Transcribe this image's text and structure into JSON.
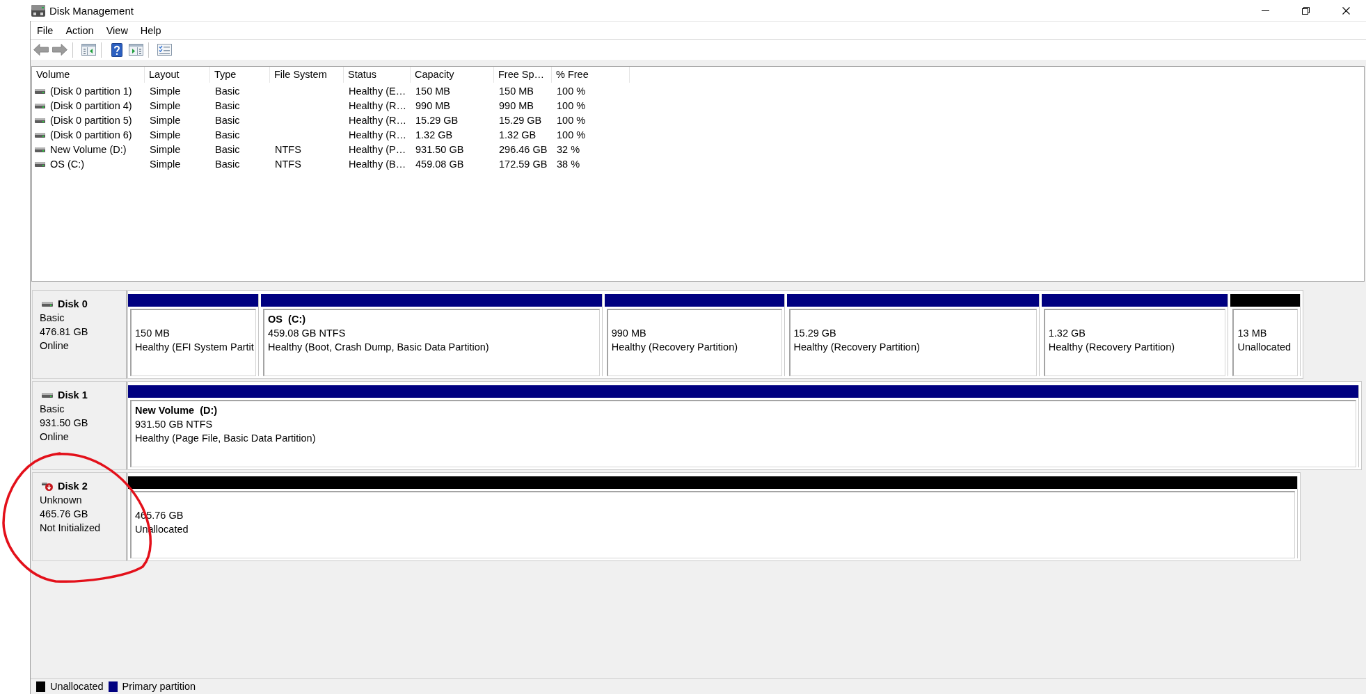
{
  "window": {
    "title": "Disk Management"
  },
  "menu": [
    "File",
    "Action",
    "View",
    "Help"
  ],
  "toolbar": [
    {
      "buttons": [
        {
          "kind": "back",
          "disabled": true
        },
        {
          "kind": "forward",
          "disabled": true
        }
      ]
    },
    {
      "buttons": [
        {
          "kind": "console-tree",
          "disabled": false
        }
      ]
    },
    {
      "buttons": [
        {
          "kind": "help",
          "disabled": false
        },
        {
          "kind": "action-pane",
          "disabled": false
        }
      ]
    },
    {
      "buttons": [
        {
          "kind": "properties",
          "disabled": false
        }
      ]
    }
  ],
  "volume_list": {
    "columns": [
      "Volume",
      "Layout",
      "Type",
      "File System",
      "Status",
      "Capacity",
      "Free Sp…",
      "% Free"
    ],
    "rows": [
      {
        "volume": "(Disk 0 partition 1)",
        "layout": "Simple",
        "type": "Basic",
        "status": "Healthy (E…",
        "capacity": "150 MB",
        "free_space": "150 MB",
        "percent_free": "100 %",
        "selected": false
      },
      {
        "volume": "(Disk 0 partition 4)",
        "layout": "Simple",
        "type": "Basic",
        "status": "Healthy (R…",
        "capacity": "990 MB",
        "free_space": "990 MB",
        "percent_free": "100 %",
        "selected": false
      },
      {
        "volume": "(Disk 0 partition 5)",
        "layout": "Simple",
        "type": "Basic",
        "status": "Healthy (R…",
        "capacity": "15.29 GB",
        "free_space": "15.29 GB",
        "percent_free": "100 %",
        "selected": false
      },
      {
        "volume": "(Disk 0 partition 6)",
        "layout": "Simple",
        "type": "Basic",
        "status": "Healthy (R…",
        "capacity": "1.32 GB",
        "free_space": "1.32 GB",
        "percent_free": "100 %",
        "selected": false
      },
      {
        "volume": "New Volume (D:)",
        "layout": "Simple",
        "type": "Basic",
        "file_system": "NTFS",
        "status": "Healthy (P…",
        "capacity": "931.50 GB",
        "free_space": "296.46 GB",
        "percent_free": "32 %",
        "selected": false
      },
      {
        "volume": "OS (C:)",
        "layout": "Simple",
        "type": "Basic",
        "file_system": "NTFS",
        "status": "Healthy (B…",
        "capacity": "459.08 GB",
        "free_space": "172.59 GB",
        "percent_free": "38 %",
        "selected": false
      }
    ]
  },
  "disks": [
    {
      "name": "Disk 0",
      "type": "Basic",
      "capacity": "476.81 GB",
      "status": "Online",
      "alert": false,
      "partitions": [
        {
          "kind": "primary",
          "size": "150 MB",
          "status": "Healthy (EFI System Partit"
        },
        {
          "kind": "primary",
          "name": "OS  (C:)",
          "size": "459.08 GB NTFS",
          "status": "Healthy (Boot, Crash Dump, Basic Data Partition)"
        },
        {
          "kind": "primary",
          "size": "990 MB",
          "status": "Healthy (Recovery Partition)"
        },
        {
          "kind": "primary",
          "size": "15.29 GB",
          "status": "Healthy (Recovery Partition)"
        },
        {
          "kind": "primary",
          "size": "1.32 GB",
          "status": "Healthy (Recovery Partition)"
        },
        {
          "kind": "unallocated",
          "size": "13 MB",
          "status": "Unallocated"
        }
      ]
    },
    {
      "name": "Disk 1",
      "type": "Basic",
      "capacity": "931.50 GB",
      "status": "Online",
      "alert": false,
      "partitions": [
        {
          "kind": "primary",
          "name": "New Volume  (D:)",
          "size": "931.50 GB NTFS",
          "status": "Healthy (Page File, Basic Data Partition)"
        }
      ]
    },
    {
      "name": "Disk 2",
      "type": "Unknown",
      "capacity": "465.76 GB",
      "status": "Not Initialized",
      "alert": true,
      "partitions": [
        {
          "kind": "unallocated",
          "size": "465.76 GB",
          "status": "Unallocated"
        }
      ]
    }
  ],
  "legend": [
    {
      "kind": "unallocated",
      "label": "Unallocated",
      "color": "#000000"
    },
    {
      "kind": "primary",
      "label": "Primary partition",
      "color": "#000080"
    }
  ]
}
